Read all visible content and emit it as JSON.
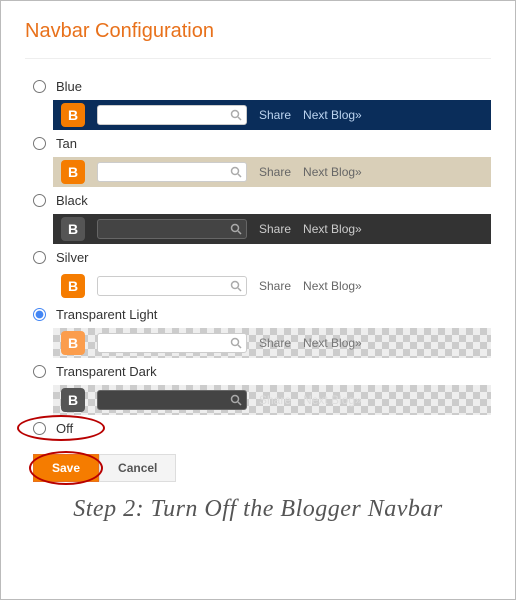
{
  "title": "Navbar Configuration",
  "options": [
    {
      "label": "Blue",
      "share": "Share",
      "next": "Next Blog»"
    },
    {
      "label": "Tan",
      "share": "Share",
      "next": "Next Blog»"
    },
    {
      "label": "Black",
      "share": "Share",
      "next": "Next Blog»"
    },
    {
      "label": "Silver",
      "share": "Share",
      "next": "Next Blog»"
    },
    {
      "label": "Transparent Light",
      "share": "Share",
      "next": "Next Blog»"
    },
    {
      "label": "Transparent Dark",
      "share": "Share",
      "next": "Next Blog»"
    },
    {
      "label": "Off"
    }
  ],
  "buttons": {
    "save": "Save",
    "cancel": "Cancel"
  },
  "caption": "Step 2: Turn Off the Blogger Navbar",
  "logo_glyph": "B"
}
